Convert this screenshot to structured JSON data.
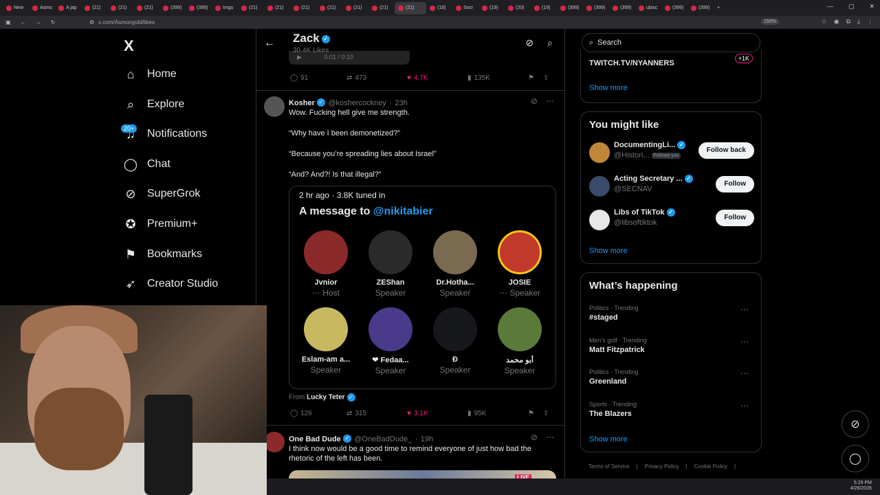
{
  "browser": {
    "tabs": [
      "New",
      "Asmo",
      "A jap",
      "(21)",
      "(21)",
      "(21)",
      "(399)",
      "(399)",
      "Imgu",
      "(21)",
      "(21)",
      "(21)",
      "(21)",
      "(21)",
      "(21)",
      "(21)",
      "(18)",
      "Socr",
      "(19)",
      "(20)",
      "(19)",
      "(399)",
      "(399)",
      "(399)",
      "ubisc",
      "(399)",
      "(399)"
    ],
    "active_tab": "(21)",
    "url": "x.com/Asmongold/likes",
    "zoom": "150%",
    "new_tab": "+"
  },
  "sidebar": {
    "logo": "X",
    "items": [
      {
        "label": "Home",
        "icon": "home-icon"
      },
      {
        "label": "Explore",
        "icon": "search-icon"
      },
      {
        "label": "Notifications",
        "icon": "bell-icon"
      },
      {
        "label": "Chat",
        "icon": "chat-bubble-icon"
      },
      {
        "label": "SuperGrok",
        "icon": "grok-icon"
      },
      {
        "label": "Premium+",
        "icon": "premium-badge-icon"
      },
      {
        "label": "Bookmarks",
        "icon": "bookmark-icon"
      },
      {
        "label": "Creator Studio",
        "icon": "rocket-icon"
      }
    ],
    "notifications_badge": "20+"
  },
  "header": {
    "title": "Zack",
    "subtitle": "30.4K Likes",
    "player_time": "0:01 / 0:10"
  },
  "tweet0": {
    "replies": "91",
    "reposts": "473",
    "likes": "4.7K",
    "views": "135K"
  },
  "tweet1": {
    "name": "Kosher",
    "handle": "@koshercockney",
    "time": "23h",
    "lines": [
      "Wow. Fucking hell give me strength.",
      "“Why have I been demonetized?”",
      "“Because you’re spreading lies about Israel”",
      "“And? And?! Is that illegal?”"
    ],
    "space": {
      "meta": "2 hr ago · 3.8K tuned in",
      "title_prefix": "A message to ",
      "mention": "@nikitabier",
      "speakers": [
        {
          "name": "Jvnior",
          "role": "⋯ Host",
          "color": "#8b2a2a"
        },
        {
          "name": "ZEShan",
          "role": "Speaker",
          "color": "#2a2a2a"
        },
        {
          "name": "Dr.Hotha...",
          "role": "Speaker",
          "color": "#7a6a50"
        },
        {
          "name": "JOSIE",
          "role": "⋯ Speaker",
          "color": "#c0392b"
        },
        {
          "name": "Eslam-am a...",
          "role": "Speaker",
          "color": "#c8b860"
        },
        {
          "name": "❤ Fedaa...",
          "role": "Speaker",
          "color": "#4a3a8a"
        },
        {
          "name": "Đ",
          "role": "Speaker",
          "color": "#16181c"
        },
        {
          "name": "أبو محمد",
          "role": "Speaker",
          "color": "#5a7a3a"
        }
      ]
    },
    "from_label": "From",
    "from_name": "Lucky Teter",
    "replies": "126",
    "reposts": "315",
    "likes": "3.1K",
    "views": "95K"
  },
  "tweet2": {
    "name": "One Bad Dude",
    "handle": "@OneBadDude_",
    "time": "19h",
    "text": "I think now would be a good time to remind everyone of just how bad the rhetoric of the left has been.",
    "media_label": "LIVE"
  },
  "right": {
    "search_placeholder": "Search",
    "top_item": "TWITCH.TV/NYANNERS",
    "top_badge": "+1K",
    "show_more": "Show more",
    "wtf_title": "You might like",
    "wtf": [
      {
        "name": "DocumentingLi...",
        "handle": "@Histori...",
        "follows_you": "Follows you",
        "button": "Follow back",
        "color": "#c0873a"
      },
      {
        "name": "Acting Secretary ...",
        "handle": "@SECNAV",
        "follows_you": "",
        "button": "Follow",
        "color": "#3a4a6a"
      },
      {
        "name": "Libs of TikTok",
        "handle": "@libsoftiktok",
        "follows_you": "",
        "button": "Follow",
        "color": "#e8e8e8"
      }
    ],
    "trends_title": "What’s happening",
    "trends": [
      {
        "context": "Politics · Trending",
        "title": "#staged"
      },
      {
        "context": "Men's golf · Trending",
        "title": "Matt Fitzpatrick"
      },
      {
        "context": "Politics · Trending",
        "title": "Greenland"
      },
      {
        "context": "Sports · Trending",
        "title": "The Blazers"
      }
    ],
    "footer": [
      "Terms of Service",
      "|",
      "Privacy Policy",
      "|",
      "Cookie Policy",
      "|"
    ]
  },
  "taskbar": {
    "time": "5:29 PM",
    "date": "4/26/2026"
  },
  "colors": {
    "accent": "#1d9bf0",
    "like": "#f91880",
    "background": "#000000"
  }
}
